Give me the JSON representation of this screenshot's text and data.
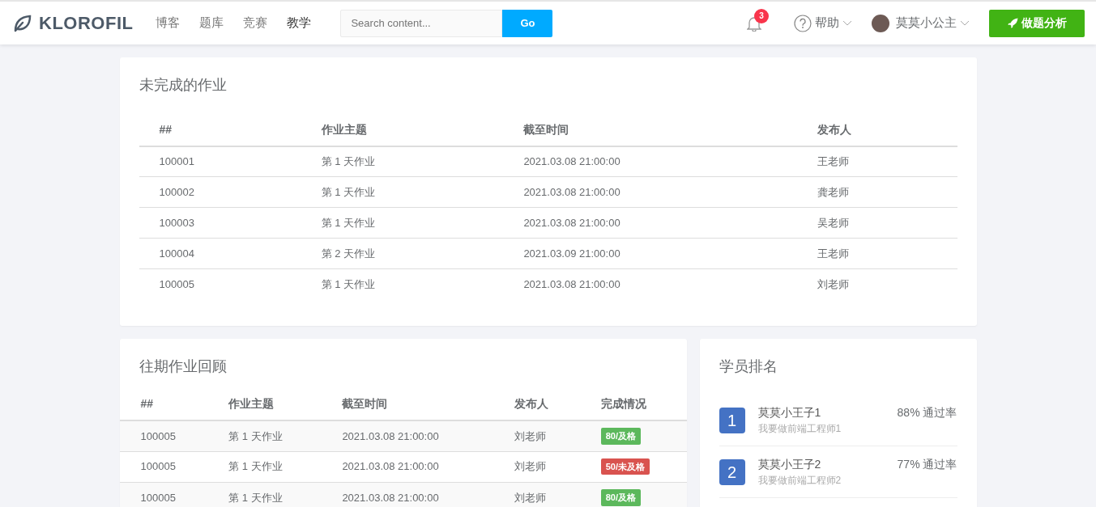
{
  "navbar": {
    "brand": "KLOROFIL",
    "nav_items": [
      {
        "label": "博客",
        "selected": false
      },
      {
        "label": "题库",
        "selected": false
      },
      {
        "label": "竞赛",
        "selected": false
      },
      {
        "label": "教学",
        "selected": true
      }
    ],
    "search": {
      "placeholder": "Search content...",
      "button": "Go"
    },
    "notification_count": "3",
    "help": "帮助",
    "user": "莫莫小公主",
    "action_button": "做题分析"
  },
  "pending_homework": {
    "title": "未完成的作业",
    "columns": [
      "##",
      "作业主题",
      "截至时间",
      "发布人"
    ],
    "rows": [
      [
        "100001",
        "第 1 天作业",
        "2021.03.08 21:00:00",
        "王老师"
      ],
      [
        "100002",
        "第 1 天作业",
        "2021.03.08 21:00:00",
        "龚老师"
      ],
      [
        "100003",
        "第 1 天作业",
        "2021.03.08 21:00:00",
        "吴老师"
      ],
      [
        "100004",
        "第 2 天作业",
        "2021.03.09 21:00:00",
        "王老师"
      ],
      [
        "100005",
        "第 1 天作业",
        "2021.03.08 21:00:00",
        "刘老师"
      ]
    ]
  },
  "past_homework": {
    "title": "往期作业回顾",
    "columns": [
      "##",
      "作业主题",
      "截至时间",
      "发布人",
      "完成情况"
    ],
    "rows": [
      {
        "cells": [
          "100005",
          "第 1 天作业",
          "2021.03.08 21:00:00",
          "刘老师"
        ],
        "status": "80/及格",
        "passed": true
      },
      {
        "cells": [
          "100005",
          "第 1 天作业",
          "2021.03.08 21:00:00",
          "刘老师"
        ],
        "status": "50/未及格",
        "passed": false
      },
      {
        "cells": [
          "100005",
          "第 1 天作业",
          "2021.03.08 21:00:00",
          "刘老师"
        ],
        "status": "80/及格",
        "passed": true
      }
    ]
  },
  "ranking": {
    "title": "学员排名",
    "items": [
      {
        "rank": "1",
        "name": "莫莫小王子1",
        "motto": "我要做前端工程师1",
        "rate": "88% 通过率"
      },
      {
        "rank": "2",
        "name": "莫莫小王子2",
        "motto": "我要做前端工程师2",
        "rate": "77% 通过率"
      }
    ]
  }
}
